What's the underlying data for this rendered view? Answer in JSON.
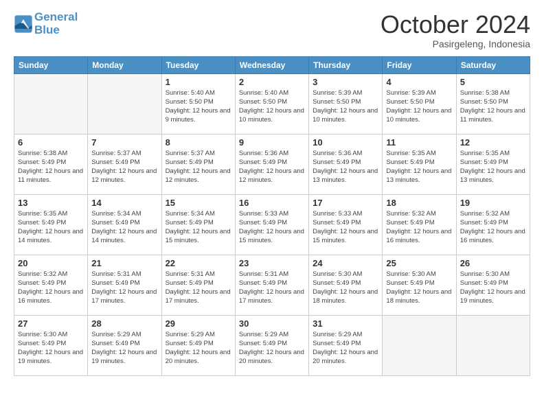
{
  "logo": {
    "line1": "General",
    "line2": "Blue"
  },
  "header": {
    "month": "October 2024",
    "location": "Pasirgeleng, Indonesia"
  },
  "weekdays": [
    "Sunday",
    "Monday",
    "Tuesday",
    "Wednesday",
    "Thursday",
    "Friday",
    "Saturday"
  ],
  "weeks": [
    [
      {
        "day": "",
        "info": ""
      },
      {
        "day": "",
        "info": ""
      },
      {
        "day": "1",
        "info": "Sunrise: 5:40 AM\nSunset: 5:50 PM\nDaylight: 12 hours and 9 minutes."
      },
      {
        "day": "2",
        "info": "Sunrise: 5:40 AM\nSunset: 5:50 PM\nDaylight: 12 hours and 10 minutes."
      },
      {
        "day": "3",
        "info": "Sunrise: 5:39 AM\nSunset: 5:50 PM\nDaylight: 12 hours and 10 minutes."
      },
      {
        "day": "4",
        "info": "Sunrise: 5:39 AM\nSunset: 5:50 PM\nDaylight: 12 hours and 10 minutes."
      },
      {
        "day": "5",
        "info": "Sunrise: 5:38 AM\nSunset: 5:50 PM\nDaylight: 12 hours and 11 minutes."
      }
    ],
    [
      {
        "day": "6",
        "info": "Sunrise: 5:38 AM\nSunset: 5:49 PM\nDaylight: 12 hours and 11 minutes."
      },
      {
        "day": "7",
        "info": "Sunrise: 5:37 AM\nSunset: 5:49 PM\nDaylight: 12 hours and 12 minutes."
      },
      {
        "day": "8",
        "info": "Sunrise: 5:37 AM\nSunset: 5:49 PM\nDaylight: 12 hours and 12 minutes."
      },
      {
        "day": "9",
        "info": "Sunrise: 5:36 AM\nSunset: 5:49 PM\nDaylight: 12 hours and 12 minutes."
      },
      {
        "day": "10",
        "info": "Sunrise: 5:36 AM\nSunset: 5:49 PM\nDaylight: 12 hours and 13 minutes."
      },
      {
        "day": "11",
        "info": "Sunrise: 5:35 AM\nSunset: 5:49 PM\nDaylight: 12 hours and 13 minutes."
      },
      {
        "day": "12",
        "info": "Sunrise: 5:35 AM\nSunset: 5:49 PM\nDaylight: 12 hours and 13 minutes."
      }
    ],
    [
      {
        "day": "13",
        "info": "Sunrise: 5:35 AM\nSunset: 5:49 PM\nDaylight: 12 hours and 14 minutes."
      },
      {
        "day": "14",
        "info": "Sunrise: 5:34 AM\nSunset: 5:49 PM\nDaylight: 12 hours and 14 minutes."
      },
      {
        "day": "15",
        "info": "Sunrise: 5:34 AM\nSunset: 5:49 PM\nDaylight: 12 hours and 15 minutes."
      },
      {
        "day": "16",
        "info": "Sunrise: 5:33 AM\nSunset: 5:49 PM\nDaylight: 12 hours and 15 minutes."
      },
      {
        "day": "17",
        "info": "Sunrise: 5:33 AM\nSunset: 5:49 PM\nDaylight: 12 hours and 15 minutes."
      },
      {
        "day": "18",
        "info": "Sunrise: 5:32 AM\nSunset: 5:49 PM\nDaylight: 12 hours and 16 minutes."
      },
      {
        "day": "19",
        "info": "Sunrise: 5:32 AM\nSunset: 5:49 PM\nDaylight: 12 hours and 16 minutes."
      }
    ],
    [
      {
        "day": "20",
        "info": "Sunrise: 5:32 AM\nSunset: 5:49 PM\nDaylight: 12 hours and 16 minutes."
      },
      {
        "day": "21",
        "info": "Sunrise: 5:31 AM\nSunset: 5:49 PM\nDaylight: 12 hours and 17 minutes."
      },
      {
        "day": "22",
        "info": "Sunrise: 5:31 AM\nSunset: 5:49 PM\nDaylight: 12 hours and 17 minutes."
      },
      {
        "day": "23",
        "info": "Sunrise: 5:31 AM\nSunset: 5:49 PM\nDaylight: 12 hours and 17 minutes."
      },
      {
        "day": "24",
        "info": "Sunrise: 5:30 AM\nSunset: 5:49 PM\nDaylight: 12 hours and 18 minutes."
      },
      {
        "day": "25",
        "info": "Sunrise: 5:30 AM\nSunset: 5:49 PM\nDaylight: 12 hours and 18 minutes."
      },
      {
        "day": "26",
        "info": "Sunrise: 5:30 AM\nSunset: 5:49 PM\nDaylight: 12 hours and 19 minutes."
      }
    ],
    [
      {
        "day": "27",
        "info": "Sunrise: 5:30 AM\nSunset: 5:49 PM\nDaylight: 12 hours and 19 minutes."
      },
      {
        "day": "28",
        "info": "Sunrise: 5:29 AM\nSunset: 5:49 PM\nDaylight: 12 hours and 19 minutes."
      },
      {
        "day": "29",
        "info": "Sunrise: 5:29 AM\nSunset: 5:49 PM\nDaylight: 12 hours and 20 minutes."
      },
      {
        "day": "30",
        "info": "Sunrise: 5:29 AM\nSunset: 5:49 PM\nDaylight: 12 hours and 20 minutes."
      },
      {
        "day": "31",
        "info": "Sunrise: 5:29 AM\nSunset: 5:49 PM\nDaylight: 12 hours and 20 minutes."
      },
      {
        "day": "",
        "info": ""
      },
      {
        "day": "",
        "info": ""
      }
    ]
  ]
}
